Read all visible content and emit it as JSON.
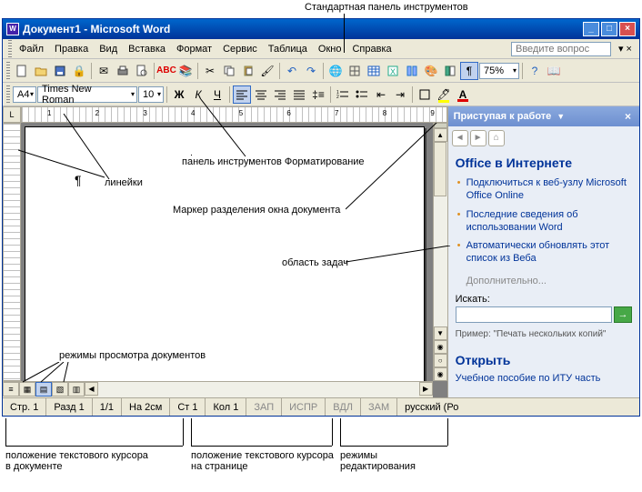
{
  "callouts": {
    "top": "Стандартная панель инструментов",
    "formatting": "панель инструментов Форматирование",
    "rulers": "линейки",
    "split": "Маркер разделения окна документа",
    "taskpane": "область задач",
    "viewmodes": "режимы просмотра документов",
    "cursor_doc": "положение текстового курсора\nв документе",
    "cursor_page": "положение текстового курсора\nна странице",
    "edit_modes": "режимы\nредактирования"
  },
  "title": "Документ1 - Microsoft Word",
  "menu": [
    "Файл",
    "Правка",
    "Вид",
    "Вставка",
    "Формат",
    "Сервис",
    "Таблица",
    "Окно",
    "Справка"
  ],
  "help_placeholder": "Введите вопрос",
  "tb1": {
    "zoom": "75%"
  },
  "tb2": {
    "style": "A4",
    "font": "Times New Roman",
    "size": "10"
  },
  "ruler_corner": "L",
  "paragraph_mark": "¶",
  "taskpane": {
    "title": "Приступая к работе",
    "section1": "Office в Интернете",
    "links": [
      "Подключиться к веб-узлу Microsoft Office Online",
      "Последние сведения об использовании Word",
      "Автоматически обновлять этот список из Веба"
    ],
    "more": "Дополнительно...",
    "search_label": "Искать:",
    "example": "Пример: \"Печать нескольких копий\"",
    "section2": "Открыть",
    "open_link": "Учебное пособие по ИТУ часть"
  },
  "status": {
    "page": "Стр. 1",
    "section": "Разд 1",
    "pages": "1/1",
    "at": "На 2см",
    "line": "Ст 1",
    "col": "Кол 1",
    "rec": "ЗАП",
    "trk": "ИСПР",
    "ext": "ВДЛ",
    "ovr": "ЗАМ",
    "lang": "русский (Ро"
  }
}
